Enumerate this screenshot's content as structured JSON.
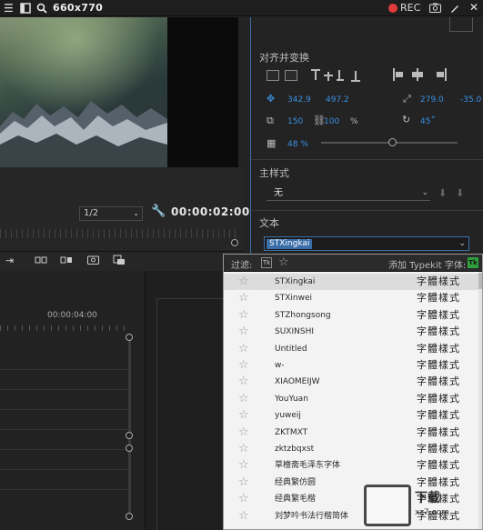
{
  "window": {
    "title": "660x770",
    "rec_label": "REC",
    "rec_color": "#e03b3b"
  },
  "monitor": {
    "zoom": "1/2",
    "timecode": "00:00:02:00"
  },
  "timeline": {
    "time_label": "00:00:04:00"
  },
  "panel": {
    "align_section": "对齐并变换",
    "position_x": "342.9",
    "position_y": "497.2",
    "width": "279.0",
    "height": "-35.0",
    "scale": "150",
    "scale_pct": "100",
    "percent_sign": "%",
    "rotation": "45",
    "degree_sign": "°",
    "opacity": "48 %",
    "master_style_section": "主样式",
    "master_style_value": "无",
    "text_section": "文本",
    "font_value": "STXingkai",
    "accent_color": "#3a90e0"
  },
  "font_popup": {
    "filter_label": "过滤:",
    "tk_label": "Tk",
    "typekit_label": "添加 Typekit 字体:",
    "fonts": [
      {
        "name": "STXingkai",
        "sample": "字體樣式"
      },
      {
        "name": "STXinwei",
        "sample": "字體樣式"
      },
      {
        "name": "STZhongsong",
        "sample": "字體樣式"
      },
      {
        "name": "SUXINSHI",
        "sample": "字體樣式"
      },
      {
        "name": "Untitled",
        "sample": "字體樣式"
      },
      {
        "name": "w-",
        "sample": "字體樣式"
      },
      {
        "name": "XIAOMEIJW",
        "sample": "字體樣式"
      },
      {
        "name": "YouYuan",
        "sample": "字體樣式"
      },
      {
        "name": "yuweij",
        "sample": "字體樣式"
      },
      {
        "name": "ZKTMXT",
        "sample": "字體樣式"
      },
      {
        "name": "zktzbqxst",
        "sample": "字體樣式"
      },
      {
        "name": "草檀斋毛泽东字体",
        "sample": "字體樣式"
      },
      {
        "name": "经典繁仿圆",
        "sample": "字體樣式"
      },
      {
        "name": "经典繁毛楷",
        "sample": "字體樣式"
      },
      {
        "name": "刘梦吟书法行楷简体",
        "sample": "字體樣式"
      }
    ]
  }
}
